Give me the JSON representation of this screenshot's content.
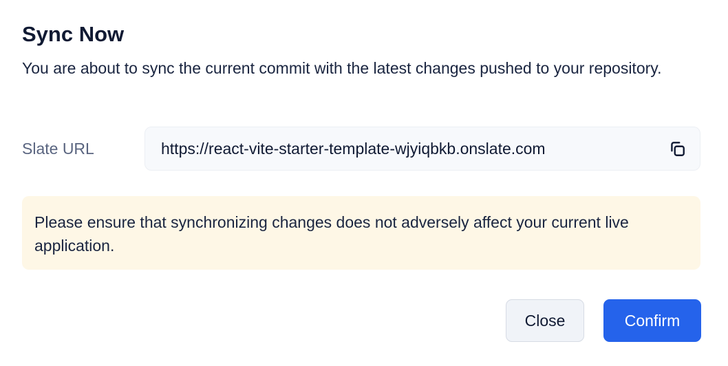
{
  "dialog": {
    "title": "Sync Now",
    "description": "You are about to sync the current commit with the latest changes pushed to your repository.",
    "url_label": "Slate URL",
    "url_value": "https://react-vite-starter-template-wjyiqbkb.onslate.com",
    "copy_icon": "copy-icon",
    "notice": "Please ensure that synchronizing changes does not adversely affect your current live application.",
    "close_label": "Close",
    "confirm_label": "Confirm"
  },
  "colors": {
    "accent": "#2563eb",
    "notice_bg": "#fef7e6",
    "field_bg": "#f7f9fc"
  }
}
